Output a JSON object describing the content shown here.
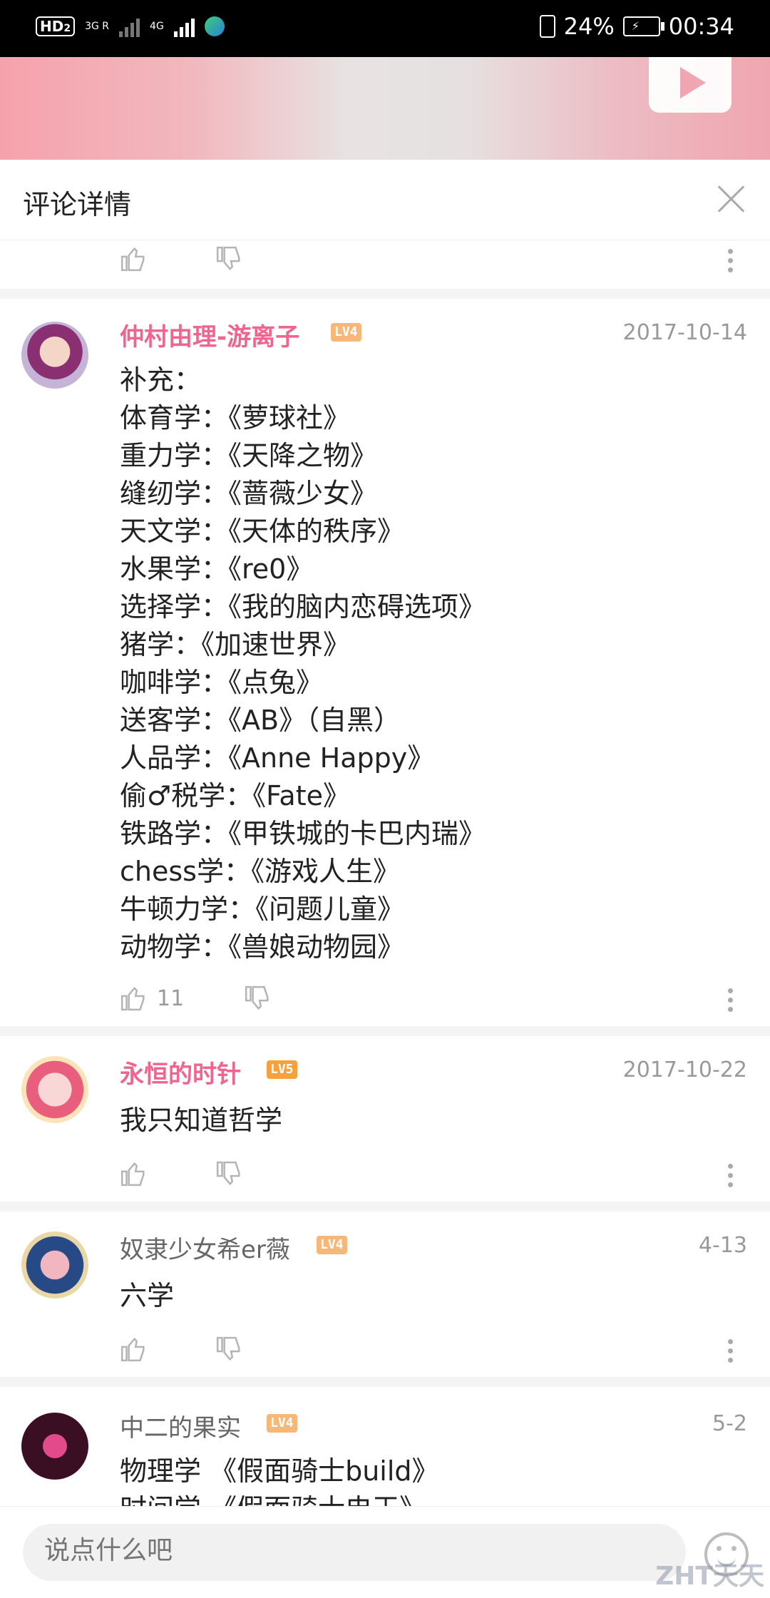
{
  "status_bar": {
    "hd_label": "HD",
    "sim_index": "2",
    "net1_label": "3G R",
    "net2_label": "4G",
    "battery_pct": "24%",
    "time": "00:34"
  },
  "header": {
    "title": "评论详情"
  },
  "comments": [
    {
      "username": "仲村由理-游离子",
      "level": "LV4",
      "date": "2017-10-14",
      "lines": [
        "补充：",
        "体育学：《萝球社》",
        "重力学：《天降之物》",
        "缝纫学：《蔷薇少女》",
        "天文学：《天体的秩序》",
        "水果学：《re0》",
        "选择学：《我的脑内恋碍选项》",
        "猪学：《加速世界》",
        "咖啡学：《点兔》",
        "送客学：《AB》（自黑）",
        "人品学：《Anne Happy》",
        "偷♂税学：《Fate》",
        "铁路学：《甲铁城的卡巴内瑞》",
        "chess学：《游戏人生》",
        "牛顿力学：《问题儿童》",
        "动物学：《兽娘动物园》"
      ],
      "likes": "11"
    },
    {
      "username": "永恒的时针",
      "level": "LV5",
      "date": "2017-10-22",
      "lines": [
        "我只知道哲学"
      ]
    },
    {
      "username": "奴隶少女希er薇",
      "level": "LV4",
      "date": "4-13",
      "lines": [
        "六学"
      ]
    },
    {
      "username": "中二的果实",
      "level": "LV4",
      "date": "5-2",
      "lines": [
        "物理学 《假面骑士build》",
        "时间学 《假面骑士电王》"
      ]
    }
  ],
  "input": {
    "placeholder": "说点什么吧"
  },
  "watermark": "ZHT天天",
  "colors": {
    "vip_name": "#f0658f",
    "level_badge": "#f6b878",
    "banner_pink": "#f6a2ad"
  },
  "icons": [
    "like-icon",
    "dislike-icon",
    "more-icon",
    "close-icon",
    "emoji-icon",
    "play-icon"
  ]
}
